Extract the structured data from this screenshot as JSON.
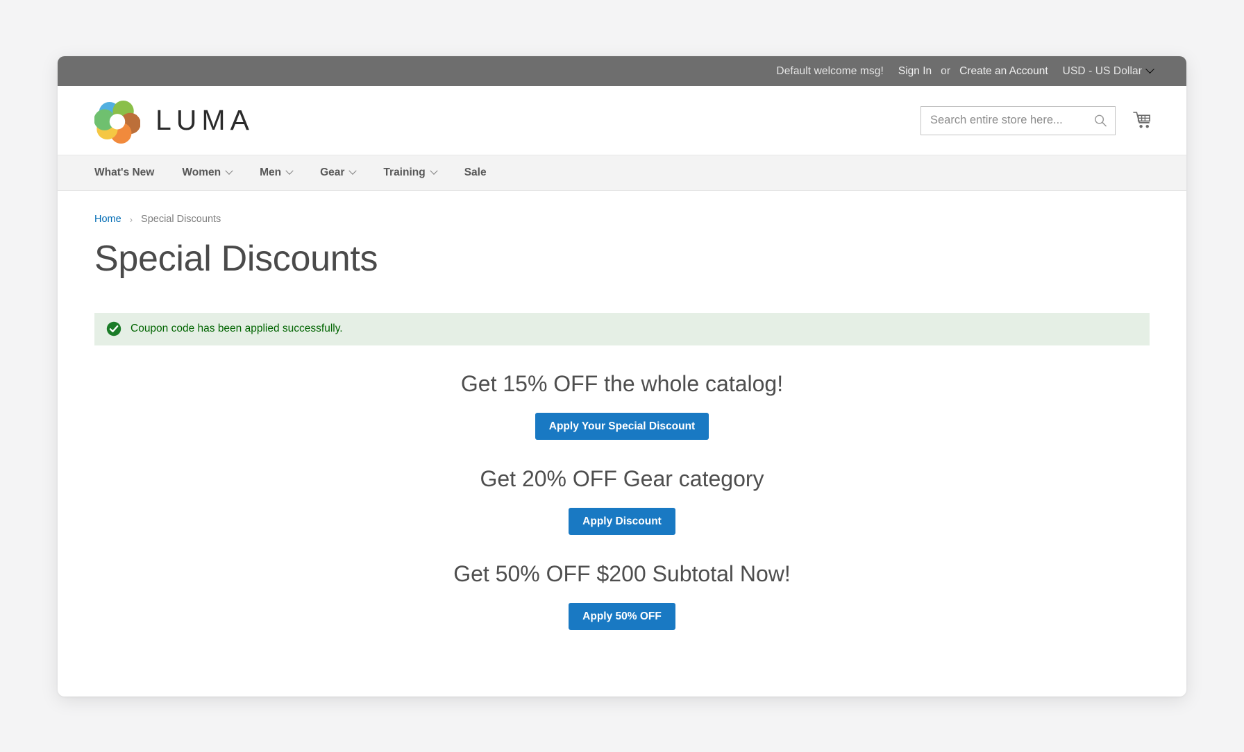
{
  "top_panel": {
    "welcome_message": "Default welcome msg!",
    "sign_in_label": "Sign In",
    "or_label": "or",
    "create_account_label": "Create an Account",
    "currency_label": "USD - US Dollar",
    "currency_chevron_icon": "chevron-down-icon",
    "background_color": "#6e6e6e"
  },
  "header": {
    "logo_name": "LUMA",
    "logo_icon": "luma-ring-logo-icon",
    "search": {
      "placeholder": "Search entire store here...",
      "value": "",
      "icon": "search-icon"
    },
    "cart_icon": "shopping-cart-icon"
  },
  "nav": {
    "items": [
      {
        "label": "What's New",
        "has_dropdown": false
      },
      {
        "label": "Women",
        "has_dropdown": true
      },
      {
        "label": "Men",
        "has_dropdown": true
      },
      {
        "label": "Gear",
        "has_dropdown": true
      },
      {
        "label": "Training",
        "has_dropdown": true
      },
      {
        "label": "Sale",
        "has_dropdown": false
      }
    ]
  },
  "breadcrumb": {
    "home_label": "Home",
    "separator": "›",
    "current_label": "Special Discounts"
  },
  "page": {
    "title": "Special Discounts"
  },
  "success_message": {
    "icon": "check-circle-icon",
    "text": "Coupon code has been applied successfully.",
    "background_color": "#e5efe5",
    "text_color": "#006400"
  },
  "promotions": {
    "accent_color": "#1979c3",
    "items": [
      {
        "headline": "Get 15% OFF the whole catalog!",
        "button_label": "Apply Your Special Discount"
      },
      {
        "headline": "Get 20% OFF Gear category",
        "button_label": "Apply Discount"
      },
      {
        "headline": "Get 50% OFF $200 Subtotal Now!",
        "button_label": "Apply 50% OFF"
      }
    ]
  }
}
